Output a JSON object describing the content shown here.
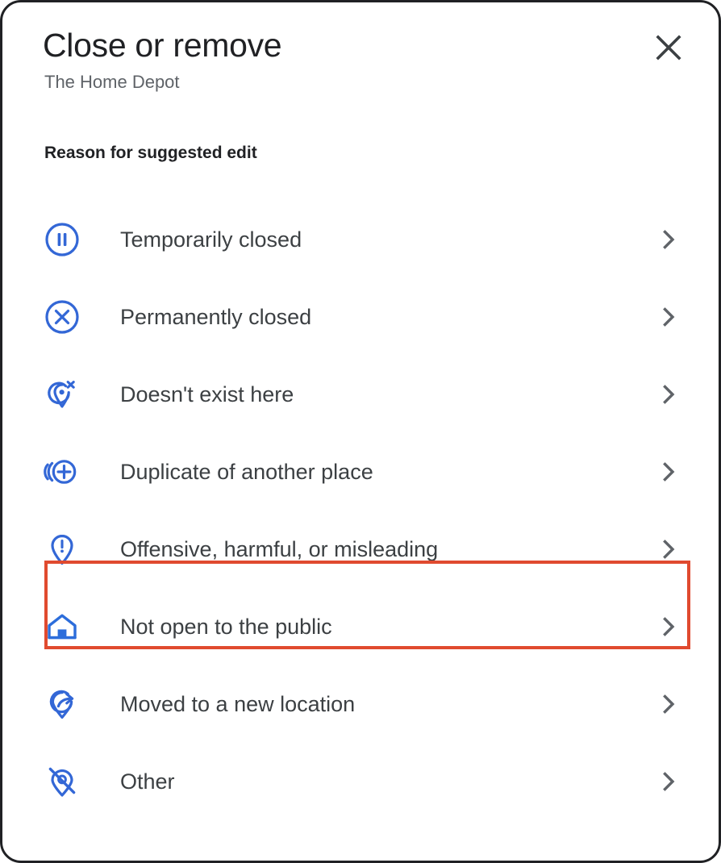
{
  "dialog": {
    "title": "Close or remove",
    "subtitle": "The Home Depot",
    "close_label": "Close",
    "section_heading": "Reason for suggested edit",
    "accent_color": "#3367d6",
    "text_color": "#3c4043",
    "highlight_color": "#e04a2f"
  },
  "reasons": [
    {
      "label": "Temporarily closed",
      "icon": "pause-circle-icon"
    },
    {
      "label": "Permanently closed",
      "icon": "x-circle-icon"
    },
    {
      "label": "Doesn't exist here",
      "icon": "pin-x-icon"
    },
    {
      "label": "Duplicate of another place",
      "icon": "duplicate-plus-icon"
    },
    {
      "label": "Offensive, harmful, or misleading",
      "icon": "pin-exclamation-icon"
    },
    {
      "label": "Not open to the public",
      "icon": "home-icon"
    },
    {
      "label": "Moved to a new location",
      "icon": "pin-arrow-icon"
    },
    {
      "label": "Other",
      "icon": "pin-slash-icon"
    }
  ],
  "highlighted_reason": "Not open to the public"
}
